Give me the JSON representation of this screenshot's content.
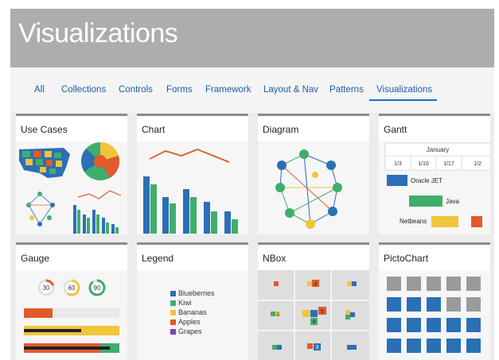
{
  "header": {
    "title": "Visualizations"
  },
  "nav": {
    "tabs": [
      {
        "label": "All"
      },
      {
        "label": "Collections"
      },
      {
        "label": "Controls"
      },
      {
        "label": "Forms"
      },
      {
        "label": "Framework"
      },
      {
        "label": "Layout & Nav"
      },
      {
        "label": "Patterns"
      },
      {
        "label": "Visualizations"
      }
    ],
    "active": "Visualizations"
  },
  "cards": {
    "use_cases": {
      "title": "Use Cases"
    },
    "chart": {
      "title": "Chart"
    },
    "diagram": {
      "title": "Diagram"
    },
    "gantt": {
      "title": "Gantt",
      "month": "January",
      "dates": [
        "1/3",
        "1/10",
        "1/17",
        "1/2"
      ],
      "tasks": [
        "Oracle JET",
        "Java",
        "Netbeans"
      ]
    },
    "gauge": {
      "title": "Gauge",
      "values": [
        30,
        60,
        90
      ]
    },
    "legend": {
      "title": "Legend",
      "items": [
        {
          "label": "Blueberries",
          "color": "#2b6fb5"
        },
        {
          "label": "Kiwi",
          "color": "#3fae6a"
        },
        {
          "label": "Bananas",
          "color": "#f0c53a"
        },
        {
          "label": "Apples",
          "color": "#e05a2b"
        },
        {
          "label": "Grapes",
          "color": "#7a45b0"
        }
      ]
    },
    "nbox": {
      "title": "NBox",
      "counts": [
        "2",
        "4",
        "3",
        "5",
        "4",
        "2",
        "3"
      ]
    },
    "pictochart": {
      "title": "PictoChart"
    }
  },
  "colors": {
    "blue": "#2b6fb5",
    "green": "#3fae6a",
    "yellow": "#f0c53a",
    "red": "#e05a2b",
    "gray": "#9a9a9a",
    "header_bg": "#adadad",
    "accent": "#1f6fbf"
  }
}
